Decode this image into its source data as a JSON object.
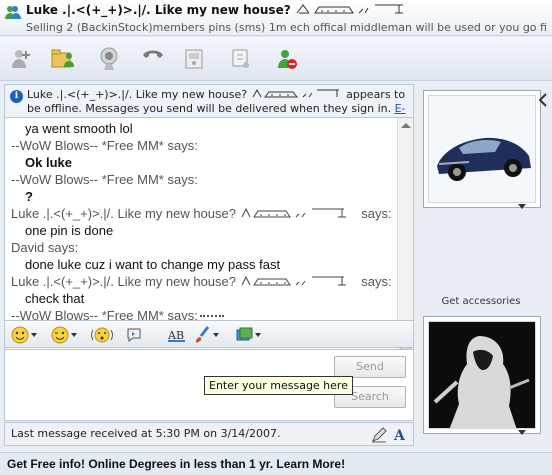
{
  "window": {
    "title": "Luke .|.<(+_+)>.|/. Like my new house? ",
    "subtitle": "Selling 2 (BackinStock)members pins (sms) 1m ech offical middleman will be used or you go fir..."
  },
  "toolbar": {
    "icons": [
      "invite-icon",
      "share-files-icon",
      "video-icon",
      "call-icon",
      "activities-icon",
      "games-icon",
      "block-icon"
    ]
  },
  "notice": {
    "text": "Luke .|.<(+_+)>.|/. Like my new house? ",
    "text2": " appears to be offline. Messages you send will be delivered when they sign in.",
    "link": "E-mail"
  },
  "conversation": [
    {
      "kind": "text",
      "value": "ya went smooth lol"
    },
    {
      "kind": "sender",
      "value": "--WoW Blows-- *Free MM* says:"
    },
    {
      "kind": "text-bold",
      "value": "Ok luke"
    },
    {
      "kind": "sender",
      "value": "--WoW Blows-- *Free MM* says:"
    },
    {
      "kind": "text-bold",
      "value": "?"
    },
    {
      "kind": "sender-art",
      "value": "Luke .|.<(+_+)>.|/. Like my new house? ",
      "suffix": " says:"
    },
    {
      "kind": "text",
      "value": "one pin is done"
    },
    {
      "kind": "sender",
      "value": "David says:"
    },
    {
      "kind": "text",
      "value": "done luke cuz i want to change my pass fast"
    },
    {
      "kind": "sender-art",
      "value": "Luke .|.<(+_+)>.|/. Like my new house? ",
      "suffix": " says:"
    },
    {
      "kind": "text",
      "value": "check that"
    },
    {
      "kind": "sender",
      "value": "--WoW Blows-- *Free MM* says:"
    }
  ],
  "compose": {
    "send_label": "Send",
    "search_label": "Search",
    "tooltip": "Enter your message here"
  },
  "status": {
    "last_message": "Last message received at 5:30 PM on 3/14/2007."
  },
  "sidebar": {
    "accessories_label": "Get accessories"
  },
  "ad": {
    "text": "Get Free info! Online Degrees in less than 1 yr. Learn More!"
  },
  "colors": {
    "link": "#1a4fd0",
    "window_bg": "#e9eef4"
  }
}
